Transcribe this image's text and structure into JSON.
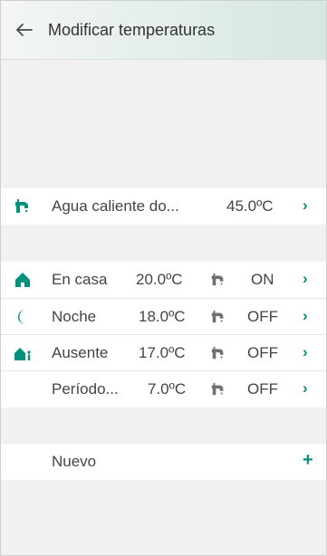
{
  "header": {
    "back_icon": "arrow-left-icon",
    "title": "Modificar temperaturas"
  },
  "hot_water": {
    "icon": "faucet-icon",
    "label": "Agua caliente do...",
    "value": "45.0ºC"
  },
  "modes": [
    {
      "icon": "home-icon",
      "label": "En casa",
      "temp": "20.0ºC",
      "water_icon": "faucet-icon",
      "state": "ON"
    },
    {
      "icon": "moon-icon",
      "label": "Noche",
      "temp": "18.0ºC",
      "water_icon": "faucet-icon",
      "state": "OFF"
    },
    {
      "icon": "away-icon",
      "label": "Ausente",
      "temp": "17.0ºC",
      "water_icon": "faucet-icon",
      "state": "OFF"
    },
    {
      "icon": "",
      "label": "Período...",
      "temp": "7.0ºC",
      "water_icon": "faucet-icon",
      "state": "OFF"
    }
  ],
  "new_item": {
    "label": "Nuevo",
    "action_icon": "plus-icon"
  },
  "colors": {
    "accent": "#00917e",
    "icon_gray": "#707070",
    "header_end": "#d6e6e1"
  }
}
